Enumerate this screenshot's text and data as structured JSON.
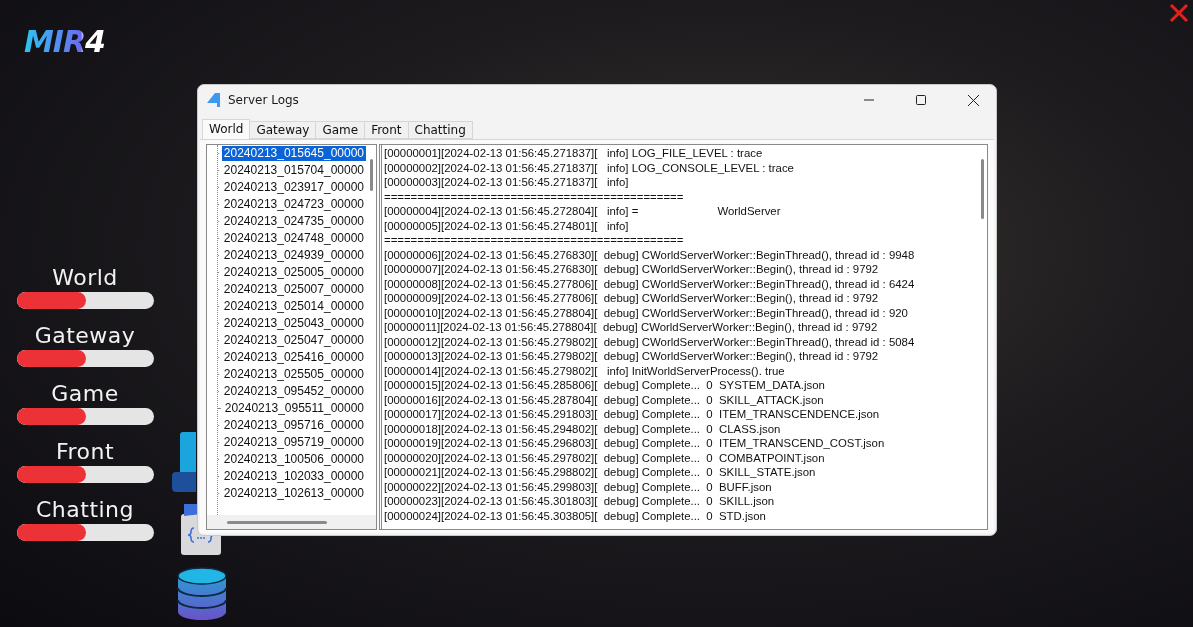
{
  "logo": {
    "text": "MIR4"
  },
  "servers": [
    {
      "name": "World",
      "level": 0.51
    },
    {
      "name": "Gateway",
      "level": 0.51
    },
    {
      "name": "Game",
      "level": 0.51
    },
    {
      "name": "Front",
      "level": 0.51
    },
    {
      "name": "Chatting",
      "level": 0.51
    }
  ],
  "window": {
    "title": "Server Logs",
    "tabs": [
      {
        "label": "World",
        "selected": true
      },
      {
        "label": "Gateway",
        "selected": false
      },
      {
        "label": "Game",
        "selected": false
      },
      {
        "label": "Front",
        "selected": false
      },
      {
        "label": "Chatting",
        "selected": false
      }
    ],
    "files": [
      {
        "name": "20240213_015645_00000",
        "selected": true
      },
      {
        "name": "20240213_015704_00000",
        "selected": false
      },
      {
        "name": "20240213_023917_00000",
        "selected": false
      },
      {
        "name": "20240213_024723_00000",
        "selected": false
      },
      {
        "name": "20240213_024735_00000",
        "selected": false
      },
      {
        "name": "20240213_024748_00000",
        "selected": false
      },
      {
        "name": "20240213_024939_00000",
        "selected": false
      },
      {
        "name": "20240213_025005_00000",
        "selected": false
      },
      {
        "name": "20240213_025007_00000",
        "selected": false
      },
      {
        "name": "20240213_025014_00000",
        "selected": false
      },
      {
        "name": "20240213_025043_00000",
        "selected": false
      },
      {
        "name": "20240213_025047_00000",
        "selected": false
      },
      {
        "name": "20240213_025416_00000",
        "selected": false
      },
      {
        "name": "20240213_025505_00000",
        "selected": false
      },
      {
        "name": "20240213_095452_00000",
        "selected": false
      },
      {
        "name": "20240213_095511_00000",
        "selected": false
      },
      {
        "name": "20240213_095716_00000",
        "selected": false
      },
      {
        "name": "20240213_095719_00000",
        "selected": false
      },
      {
        "name": "20240213_100506_00000",
        "selected": false
      },
      {
        "name": "20240213_102033_00000",
        "selected": false
      },
      {
        "name": "20240213_102613_00000",
        "selected": false
      }
    ],
    "log_lines": [
      "[00000001][2024-02-13 01:56:45.271837][   info] LOG_FILE_LEVEL : trace",
      "[00000002][2024-02-13 01:56:45.271837][   info] LOG_CONSOLE_LEVEL : trace",
      "[00000003][2024-02-13 01:56:45.271837][   info]",
      "=============================================",
      "[00000004][2024-02-13 01:56:45.272804][   info] =                         WorldServer",
      "[00000005][2024-02-13 01:56:45.274801][   info]",
      "=============================================",
      "[00000006][2024-02-13 01:56:45.276830][  debug] CWorldServerWorker::BeginThread(), thread id : 9948",
      "[00000007][2024-02-13 01:56:45.276830][  debug] CWorldServerWorker::Begin(), thread id : 9792",
      "[00000008][2024-02-13 01:56:45.277806][  debug] CWorldServerWorker::BeginThread(), thread id : 6424",
      "[00000009][2024-02-13 01:56:45.277806][  debug] CWorldServerWorker::Begin(), thread id : 9792",
      "[00000010][2024-02-13 01:56:45.278804][  debug] CWorldServerWorker::BeginThread(), thread id : 920",
      "[00000011][2024-02-13 01:56:45.278804][  debug] CWorldServerWorker::Begin(), thread id : 9792",
      "[00000012][2024-02-13 01:56:45.279802][  debug] CWorldServerWorker::BeginThread(), thread id : 5084",
      "[00000013][2024-02-13 01:56:45.279802][  debug] CWorldServerWorker::Begin(), thread id : 9792",
      "[00000014][2024-02-13 01:56:45.279802][   info] InitWorldServerProcess(). true",
      "[00000015][2024-02-13 01:56:45.285806][  debug] Complete...  0  SYSTEM_DATA.json",
      "[00000016][2024-02-13 01:56:45.287804][  debug] Complete...  0  SKILL_ATTACK.json",
      "[00000017][2024-02-13 01:56:45.291803][  debug] Complete...  0  ITEM_TRANSCENDENCE.json",
      "[00000018][2024-02-13 01:56:45.294802][  debug] Complete...  0  CLASS.json",
      "[00000019][2024-02-13 01:56:45.296803][  debug] Complete...  0  ITEM_TRANSCEND_COST.json",
      "[00000020][2024-02-13 01:56:45.297802][  debug] Complete...  0  COMBATPOINT.json",
      "[00000021][2024-02-13 01:56:45.298802][  debug] Complete...  0  SKILL_STATE.json",
      "[00000022][2024-02-13 01:56:45.299803][  debug] Complete...  0  BUFF.json",
      "[00000023][2024-02-13 01:56:45.301803][  debug] Complete...  0  SKILL.json",
      "[00000024][2024-02-13 01:56:45.303805][  debug] Complete...  0  STD.json"
    ]
  }
}
